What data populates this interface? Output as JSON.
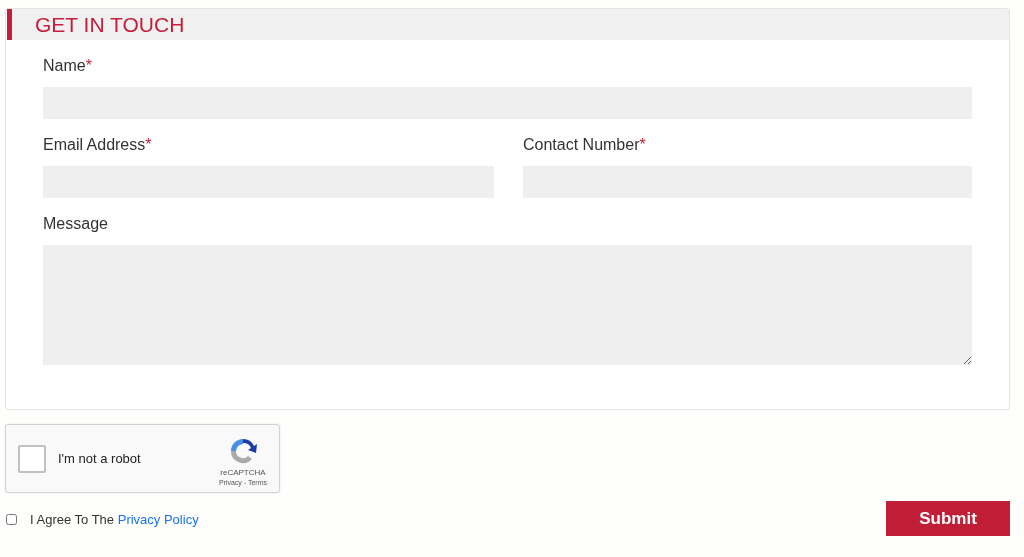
{
  "section": {
    "title": "GET IN TOUCH"
  },
  "rows": [
    [
      {
        "label": "Name",
        "required_mark": "*",
        "kind": "text"
      }
    ],
    [
      {
        "label": "Email Address",
        "required_mark": "*",
        "kind": "text"
      },
      {
        "label": "Contact Number",
        "required_mark": "*",
        "kind": "text"
      }
    ],
    [
      {
        "label": "Message",
        "kind": "textarea"
      }
    ]
  ],
  "captcha": {
    "label": "I'm not a robot",
    "checked": false,
    "brand": "reCAPTCHA",
    "links": "Privacy - Terms"
  },
  "agree": {
    "checked": false,
    "text": "I Agree To The",
    "link": "Privacy Policy"
  },
  "submit": {
    "label": "Submit"
  }
}
